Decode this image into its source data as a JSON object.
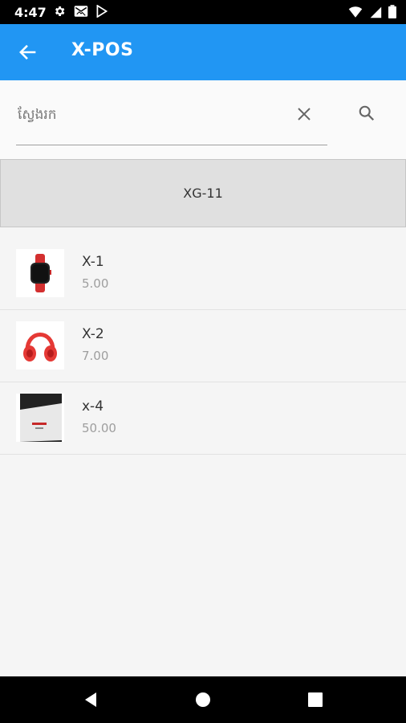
{
  "status_bar": {
    "time": "4:47",
    "left_icons": [
      "gear-icon",
      "mail-icon",
      "play-store-icon"
    ],
    "right_icons": [
      "wifi-icon",
      "signal-icon",
      "battery-icon"
    ]
  },
  "app_bar": {
    "title": "X-POS",
    "color": "#2196f3"
  },
  "search": {
    "placeholder": "ស្វែងរក",
    "value": ""
  },
  "category": {
    "label": "XG-11"
  },
  "products": [
    {
      "name": "X-1",
      "price": "5.00",
      "image": "smartwatch-image"
    },
    {
      "name": "X-2",
      "price": "7.00",
      "image": "headphones-image"
    },
    {
      "name": "x-4",
      "price": "50.00",
      "image": "box-photo-image"
    }
  ]
}
